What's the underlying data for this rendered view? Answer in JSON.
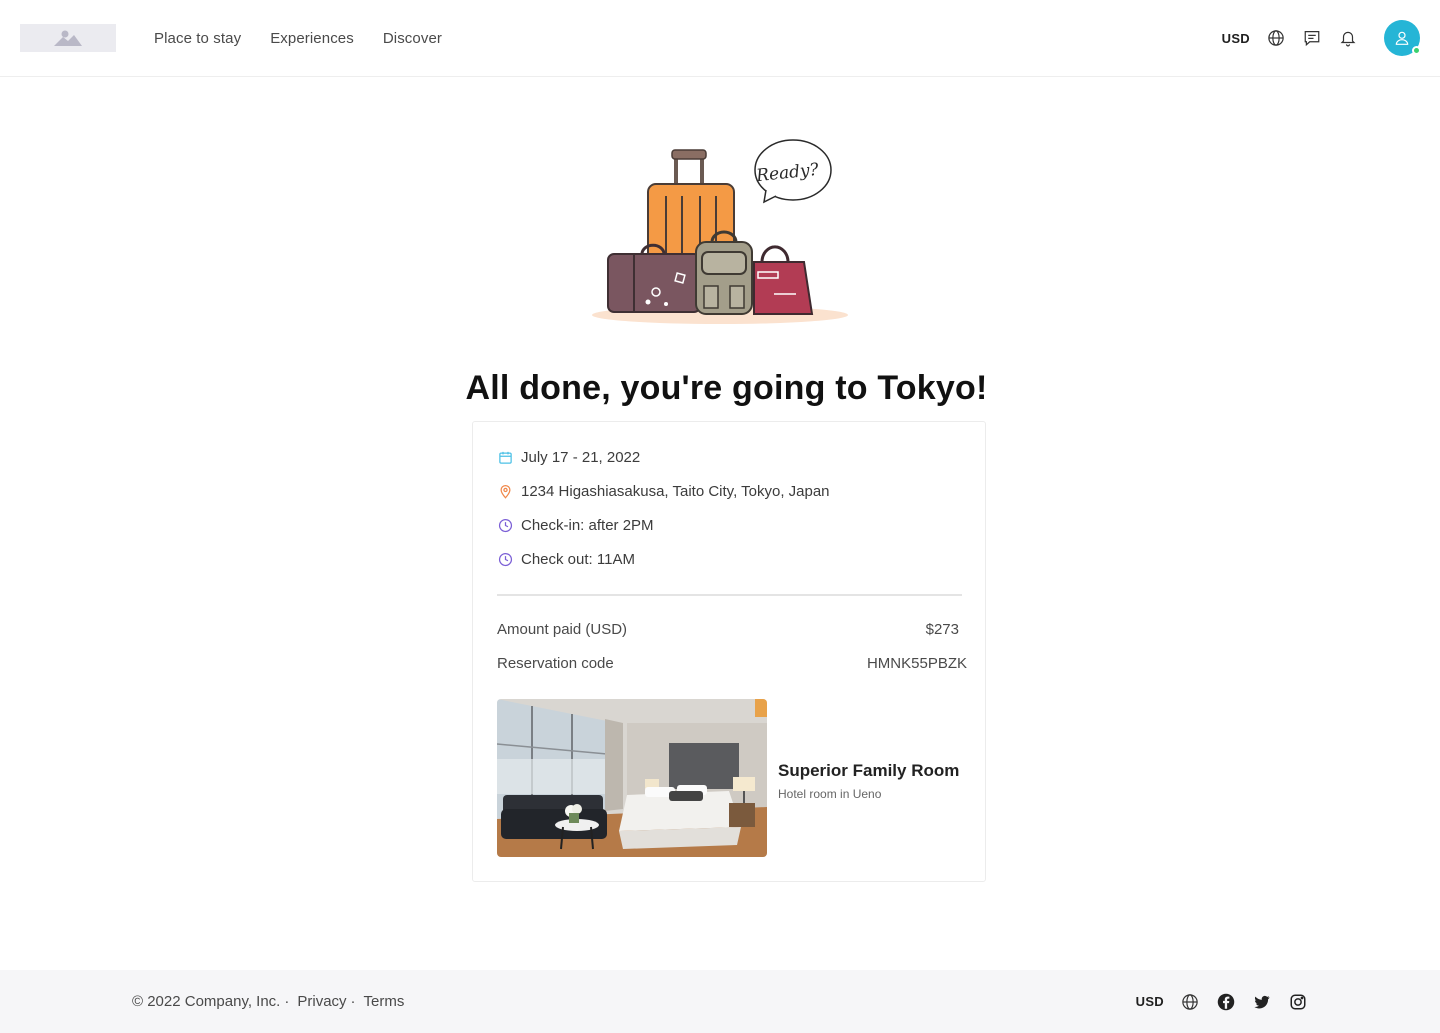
{
  "header": {
    "nav": [
      "Place to stay",
      "Experiences",
      "Discover"
    ],
    "currency": "USD",
    "icons": [
      "globe-icon",
      "message-icon",
      "bell-icon",
      "user-icon"
    ]
  },
  "illustration": {
    "speech_text": "Ready?"
  },
  "main": {
    "title": "All done, you're going to Tokyo!"
  },
  "booking": {
    "dates": "July 17 - 21, 2022",
    "address": "1234 Higashiasakusa, Taito City, Tokyo, Japan",
    "checkin": "Check-in: after 2PM",
    "checkout": "Check out: 11AM",
    "amount_label": "Amount paid (USD)",
    "amount_value": "$273",
    "code_label": "Reservation code",
    "code_value": "HMNK55PBZK",
    "room_title": "Superior Family Room",
    "room_subtitle": "Hotel room in Ueno"
  },
  "footer": {
    "copyright": "© 2022 Company, Inc.",
    "sep": "·",
    "privacy": "Privacy",
    "terms": "Terms",
    "currency": "USD",
    "icons": [
      "globe-icon",
      "facebook-icon",
      "twitter-icon",
      "instagram-icon"
    ]
  },
  "colors": {
    "accent": "#25b5d6",
    "online": "#3bd16f",
    "calendar_icon": "#4cc0e6",
    "pin_icon": "#f0884a",
    "clock_icon": "#7b5fd6"
  }
}
